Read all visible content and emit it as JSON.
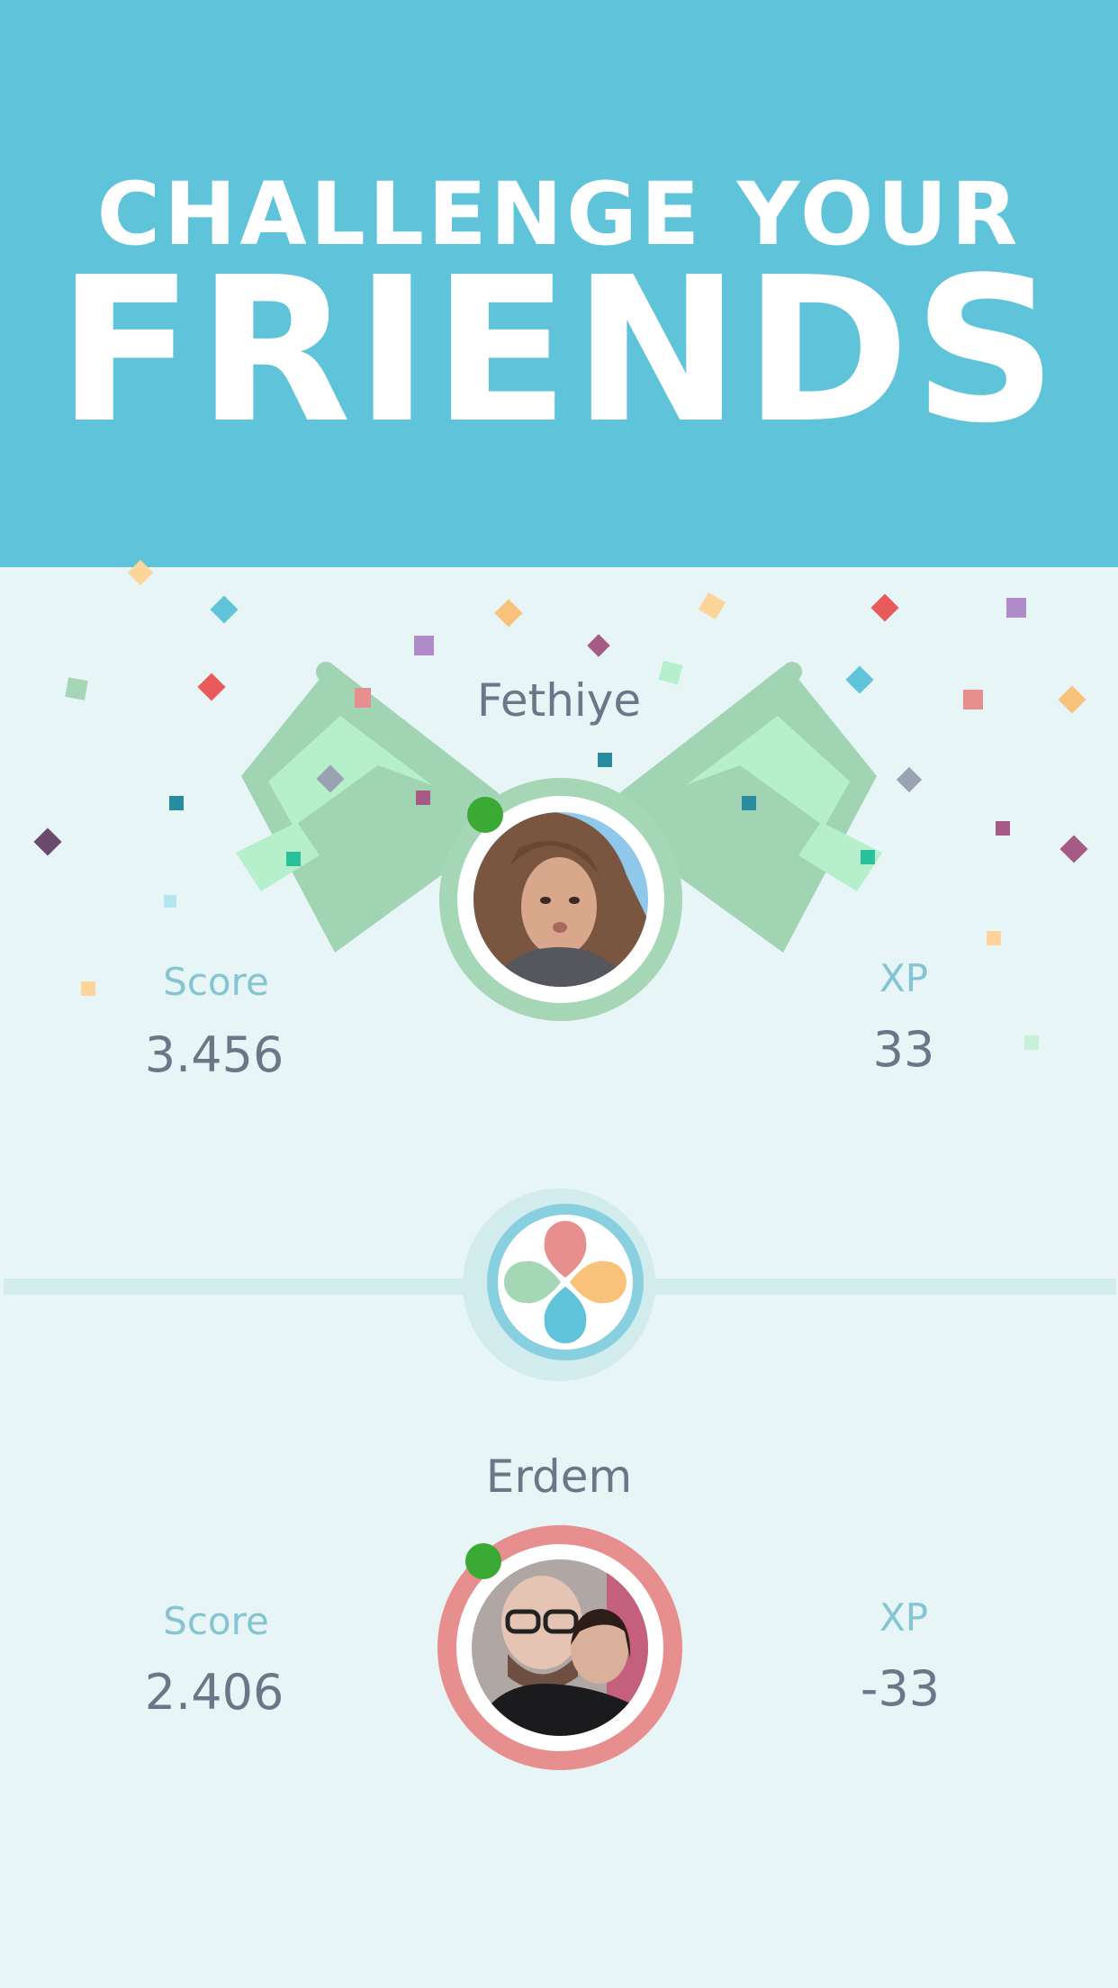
{
  "hero": {
    "line1": "CHALLENGE YOUR",
    "line2": "FRIENDS",
    "background": "#5fc3d9"
  },
  "player_top": {
    "name": "Fethiye",
    "score_label": "Score",
    "score_value": "3.456",
    "xp_label": "XP",
    "xp_value": "33",
    "ring_color": "#a5d6b6",
    "status": "online"
  },
  "player_bottom": {
    "name": "Erdem",
    "score_label": "Score",
    "score_value": "2.406",
    "xp_label": "XP",
    "xp_value": "-33",
    "ring_color": "#e78e8e",
    "status": "online"
  },
  "versus_badge": {
    "icon": "four-petal-logo-icon",
    "petal_colors": [
      "#e78e8e",
      "#f9c27b",
      "#a5d6b6",
      "#5fc3d9"
    ]
  },
  "colors": {
    "background": "#e7f5f6",
    "text": "#6d7689",
    "label": "#85c4d3",
    "online": "#3aaa35",
    "flag_light": "#b6efcb",
    "flag_dark": "#a0d4b2"
  }
}
